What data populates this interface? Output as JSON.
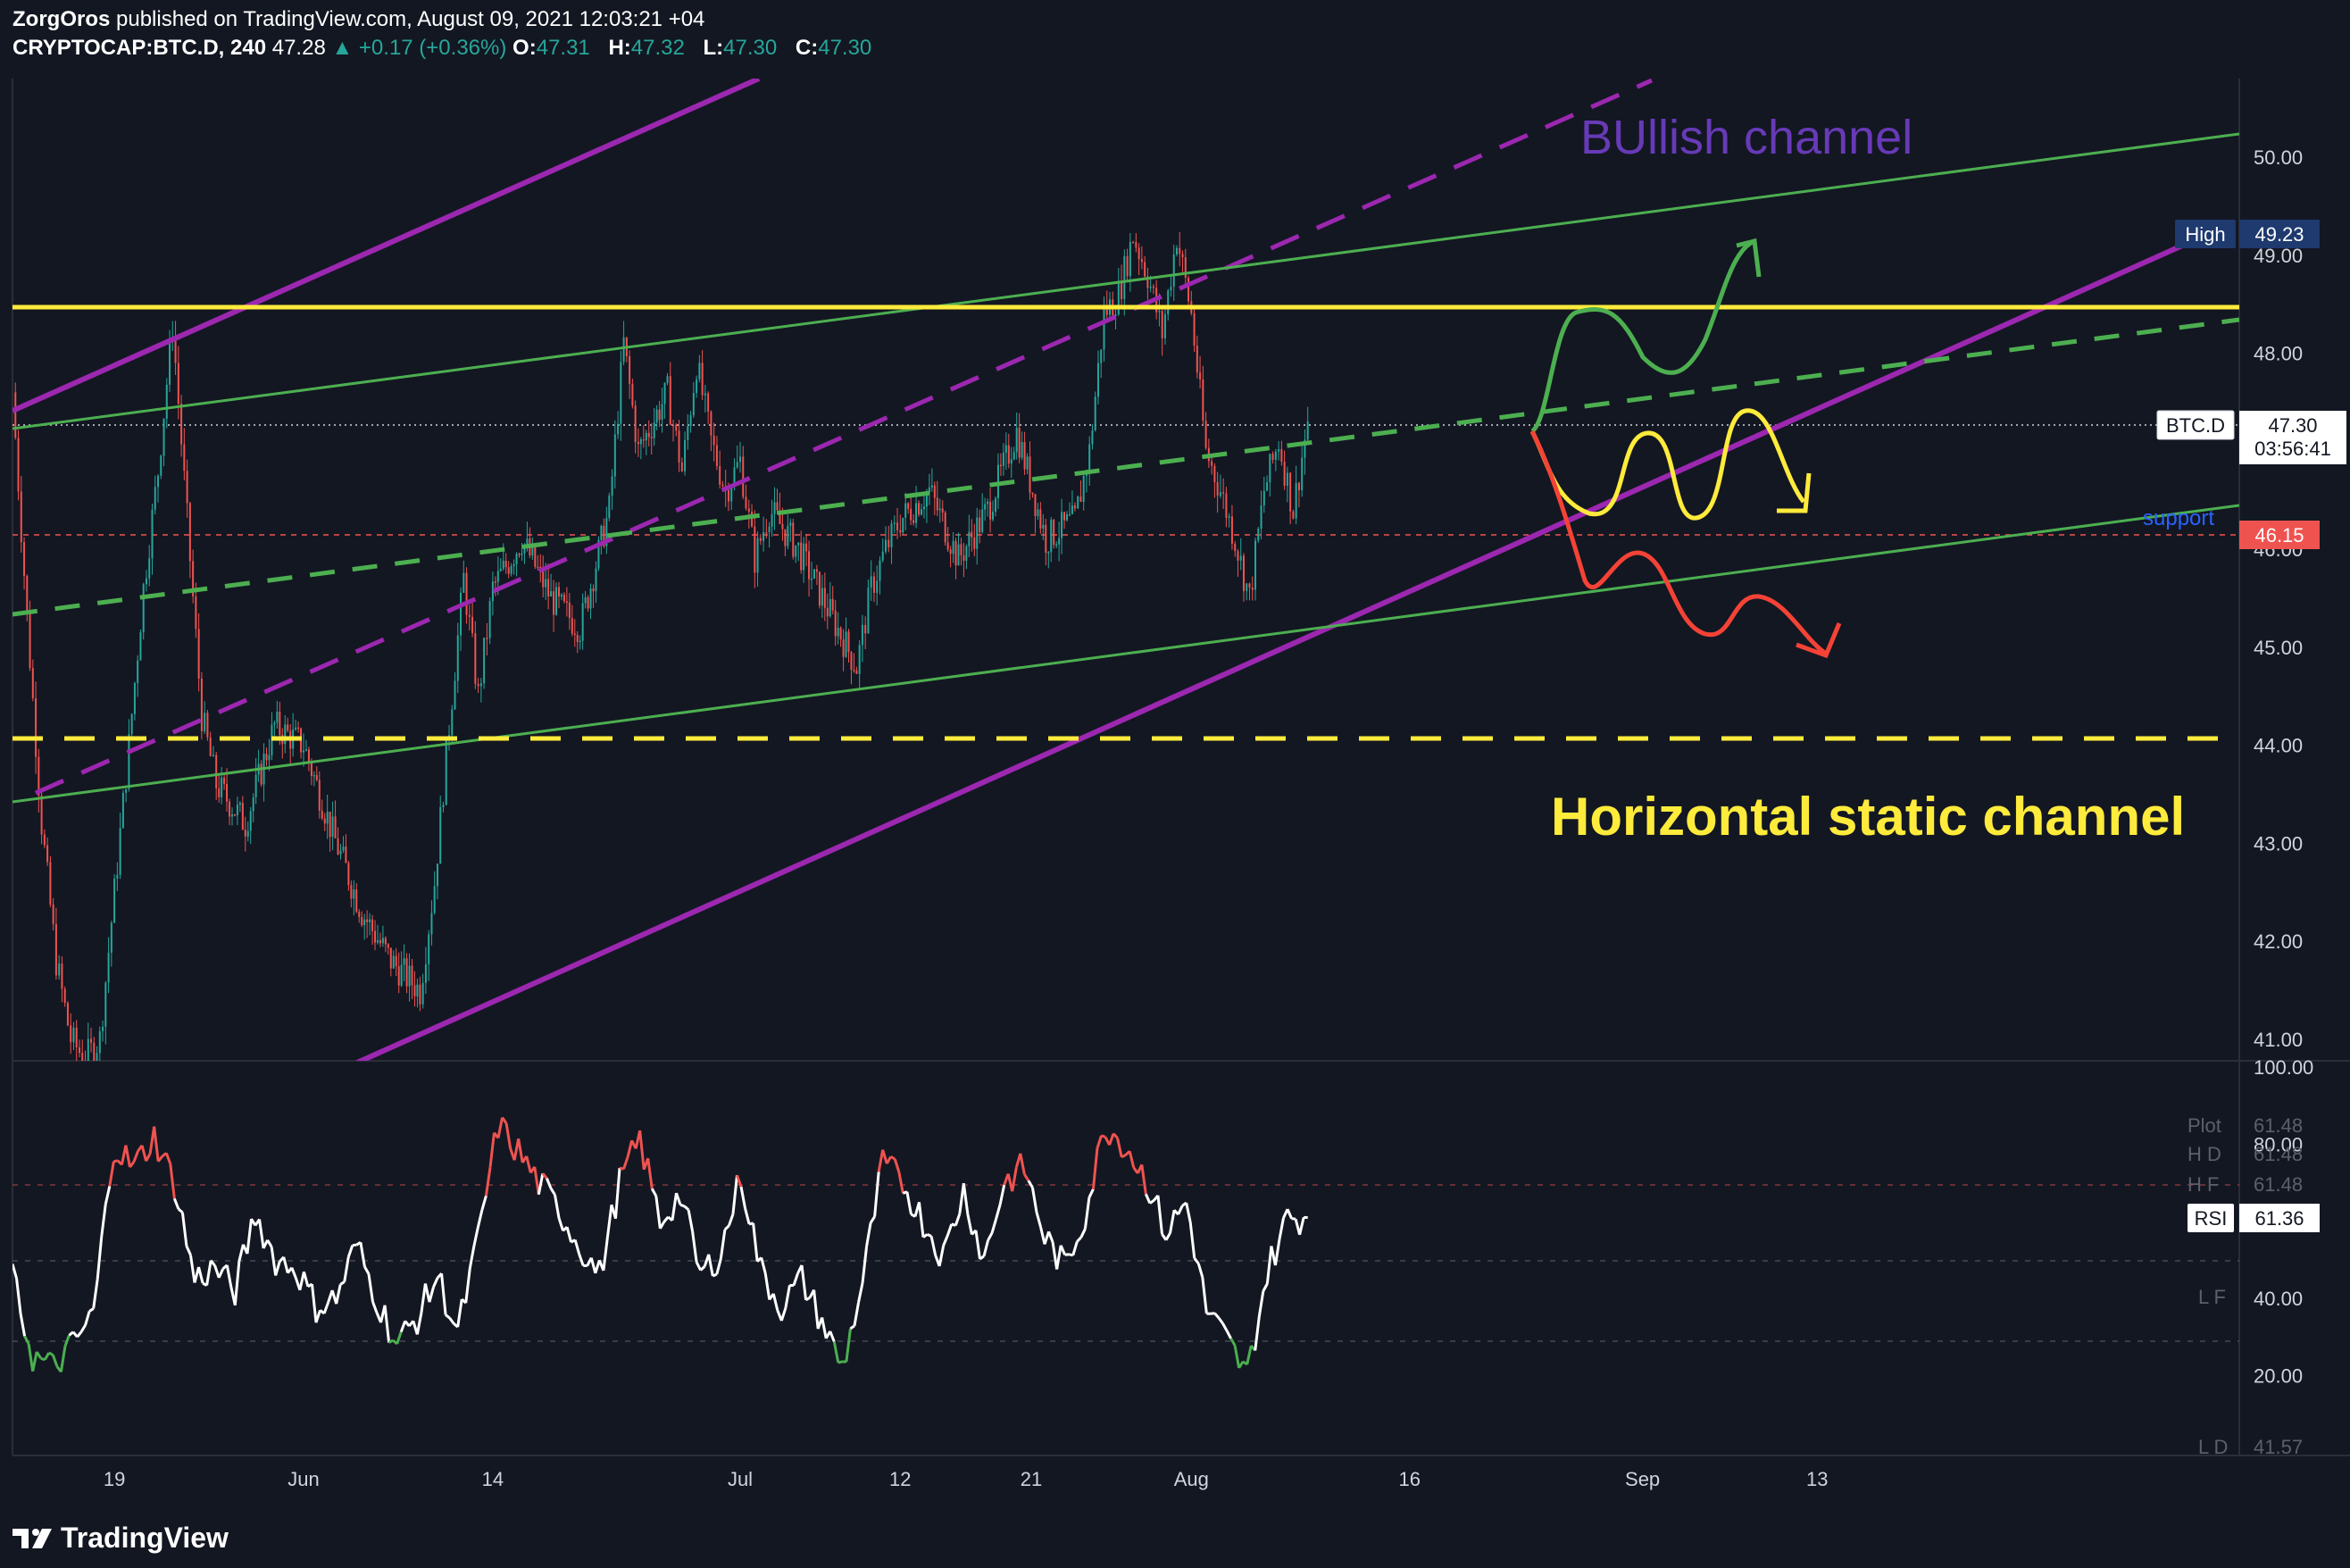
{
  "header": {
    "author": "ZorgOros",
    "published_text": "published on TradingView.com, August 09, 2021 12:03:21 +04",
    "symbol": "CRYPTOCAP:BTC.D, 240",
    "last": "47.28",
    "change": "+0.17 (+0.36%)",
    "o_label": "O:",
    "o_value": "47.31",
    "h_label": "H:",
    "h_value": "47.32",
    "l_label": "L:",
    "l_value": "47.30",
    "c_label": "C:",
    "c_value": "47.30"
  },
  "annotations": {
    "bullish_channel": "BUllish channel",
    "horizontal_channel": "Horizontal static channel",
    "support": "support"
  },
  "price_badges": {
    "high_label": "High",
    "high_value": "49.23",
    "symbol_label": "BTC.D",
    "price_value": "47.30",
    "countdown": "03:56:41",
    "support_value": "46.15"
  },
  "rsi_badges": {
    "plot_label": "Plot",
    "plot_value": "61.48",
    "hd_label": "H D",
    "hd_value": "61.48",
    "hf_label": "H F",
    "hf_value": "61.48",
    "rsi_label": "RSI",
    "rsi_value": "61.36",
    "lf_label": "L F",
    "ld_label": "L D",
    "ld_value": "41.57"
  },
  "colors": {
    "background": "#131722",
    "bull_candle": "#26a69a",
    "bear_candle": "#ef5350",
    "purple_channel": "#9c27b0",
    "green_channel": "#4caf50",
    "yellow_level": "#ffeb3b",
    "bullish_text": "#673ab7",
    "support_text": "#2962ff",
    "scenario_green": "#4caf50",
    "scenario_yellow": "#ffeb3b",
    "scenario_red": "#f44336"
  },
  "footer": {
    "brand": "TradingView"
  },
  "chart_data": {
    "type": "candlestick",
    "x_tick_labels": [
      "19",
      "Jun",
      "14",
      "Jul",
      "12",
      "21",
      "Aug",
      "16",
      "Sep",
      "13"
    ],
    "y_tick_labels": [
      "41.00",
      "42.00",
      "43.00",
      "44.00",
      "45.00",
      "46.00",
      "48.00",
      "49.00",
      "50.00"
    ],
    "ylim": [
      40.8,
      50.7
    ],
    "price_path": [
      {
        "x": "May 12",
        "y": 47.6
      },
      {
        "x": "May 13",
        "y": 45.3
      },
      {
        "x": "May 14",
        "y": 43.2
      },
      {
        "x": "May 15",
        "y": 41.8
      },
      {
        "x": "May 16",
        "y": 41.0
      },
      {
        "x": "May 17",
        "y": 40.8
      },
      {
        "x": "May 18",
        "y": 41.0
      },
      {
        "x": "May 19",
        "y": 42.5
      },
      {
        "x": "May 20",
        "y": 44.0
      },
      {
        "x": "May 21",
        "y": 45.6
      },
      {
        "x": "May 22",
        "y": 46.8
      },
      {
        "x": "May 23",
        "y": 48.3
      },
      {
        "x": "May 24",
        "y": 46.3
      },
      {
        "x": "May 25",
        "y": 44.3
      },
      {
        "x": "May 26",
        "y": 43.6
      },
      {
        "x": "May 28",
        "y": 43.2
      },
      {
        "x": "May 30",
        "y": 44.2
      },
      {
        "x": "Jun 1",
        "y": 44.0
      },
      {
        "x": "Jun 3",
        "y": 43.1
      },
      {
        "x": "Jun 5",
        "y": 42.3
      },
      {
        "x": "Jun 7",
        "y": 41.8
      },
      {
        "x": "Jun 9",
        "y": 41.5
      },
      {
        "x": "Jun 10",
        "y": 42.6
      },
      {
        "x": "Jun 11",
        "y": 44.2
      },
      {
        "x": "Jun 12",
        "y": 45.7
      },
      {
        "x": "Jun 13",
        "y": 44.5
      },
      {
        "x": "Jun 14",
        "y": 45.6
      },
      {
        "x": "Jun 16",
        "y": 46.1
      },
      {
        "x": "Jun 18",
        "y": 45.5
      },
      {
        "x": "Jun 20",
        "y": 45.2
      },
      {
        "x": "Jun 22",
        "y": 46.4
      },
      {
        "x": "Jun 23",
        "y": 48.1
      },
      {
        "x": "Jun 24",
        "y": 47.0
      },
      {
        "x": "Jun 26",
        "y": 47.6
      },
      {
        "x": "Jun 27",
        "y": 46.8
      },
      {
        "x": "Jun 28",
        "y": 47.9
      },
      {
        "x": "Jun 29",
        "y": 47.1
      },
      {
        "x": "Jun 30",
        "y": 46.6
      },
      {
        "x": "Jul 1",
        "y": 46.9
      },
      {
        "x": "Jul 2",
        "y": 45.9
      },
      {
        "x": "Jul 3",
        "y": 46.4
      },
      {
        "x": "Jul 5",
        "y": 46.0
      },
      {
        "x": "Jul 7",
        "y": 45.4
      },
      {
        "x": "Jul 9",
        "y": 44.8
      },
      {
        "x": "Jul 10",
        "y": 45.6
      },
      {
        "x": "Jul 11",
        "y": 46.0
      },
      {
        "x": "Jul 12",
        "y": 46.3
      },
      {
        "x": "Jul 14",
        "y": 46.6
      },
      {
        "x": "Jul 16",
        "y": 45.9
      },
      {
        "x": "Jul 18",
        "y": 46.4
      },
      {
        "x": "Jul 20",
        "y": 47.2
      },
      {
        "x": "Jul 22",
        "y": 46.1
      },
      {
        "x": "Jul 24",
        "y": 46.3
      },
      {
        "x": "Jul 25",
        "y": 47.0
      },
      {
        "x": "Jul 26",
        "y": 48.4
      },
      {
        "x": "Jul 27",
        "y": 48.6
      },
      {
        "x": "Jul 28",
        "y": 49.2
      },
      {
        "x": "Jul 29",
        "y": 48.8
      },
      {
        "x": "Jul 30",
        "y": 48.2
      },
      {
        "x": "Jul 31",
        "y": 49.2
      },
      {
        "x": "Aug 1",
        "y": 48.4
      },
      {
        "x": "Aug 2",
        "y": 47.0
      },
      {
        "x": "Aug 3",
        "y": 46.6
      },
      {
        "x": "Aug 4",
        "y": 46.1
      },
      {
        "x": "Aug 5",
        "y": 45.5
      },
      {
        "x": "Aug 6",
        "y": 46.6
      },
      {
        "x": "Aug 7",
        "y": 47.1
      },
      {
        "x": "Aug 8",
        "y": 46.4
      },
      {
        "x": "Aug 9",
        "y": 47.3
      }
    ],
    "levels": {
      "horizontal_resistance": 48.5,
      "horizontal_support_dashed": 44.1,
      "support": 46.15,
      "high": 49.23,
      "last_price": 47.3
    },
    "rsi": {
      "y_tick_labels": [
        "100.00",
        "80.00",
        "40.00",
        "20.00"
      ],
      "ylim": [
        0,
        100
      ],
      "values": [
        45,
        25,
        22,
        28,
        36,
        80,
        74,
        82,
        70,
        45,
        48,
        42,
        62,
        50,
        48,
        38,
        40,
        54,
        40,
        28,
        35,
        46,
        31,
        55,
        85,
        78,
        70,
        63,
        54,
        46,
        70,
        81,
        60,
        67,
        46,
        52,
        72,
        47,
        38,
        45,
        34,
        22,
        44,
        75,
        70,
        60,
        51,
        68,
        50,
        70,
        74,
        56,
        48,
        62,
        85,
        80,
        71,
        57,
        65,
        37,
        29,
        20,
        47,
        61,
        61
      ],
      "last": 61.36
    }
  }
}
